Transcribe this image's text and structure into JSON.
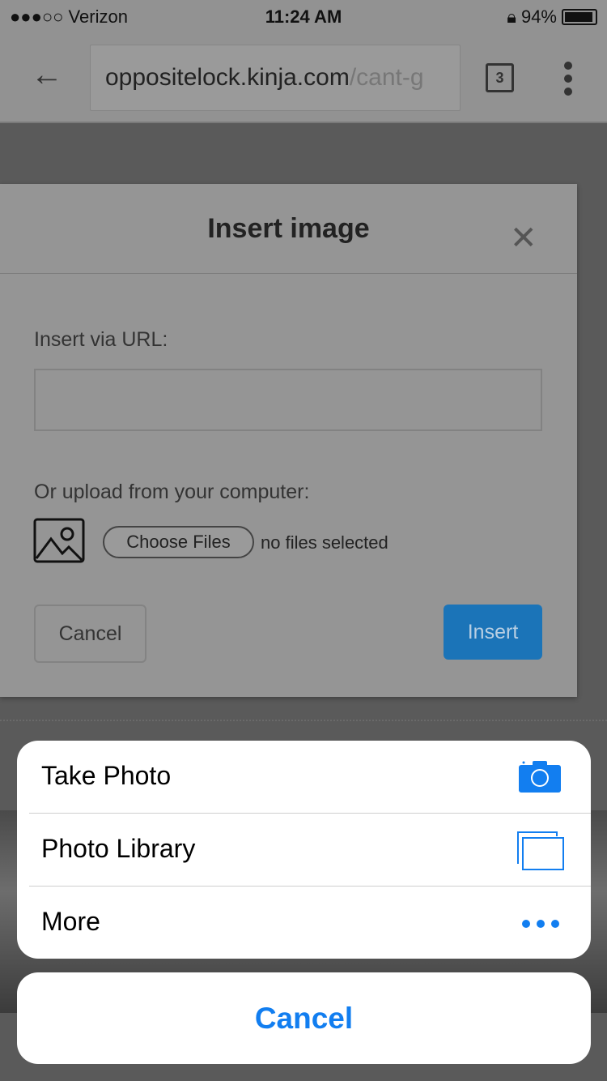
{
  "status_bar": {
    "carrier": "●●●○○ Verizon",
    "time": "11:24 AM",
    "battery": "94%",
    "battery_level": 0.94
  },
  "browser": {
    "url_main": "oppositelock.kinja.com",
    "url_rest": "/cant-g",
    "tab_count": "3"
  },
  "dialog": {
    "title": "Insert image",
    "url_label": "Insert via URL:",
    "url_value": "",
    "upload_label": "Or upload from your computer:",
    "choose_files": "Choose Files",
    "no_files": "no files selected",
    "cancel": "Cancel",
    "insert": "Insert"
  },
  "action_sheet": {
    "items": [
      {
        "label": "Take Photo",
        "icon": "camera-icon"
      },
      {
        "label": "Photo Library",
        "icon": "photo-library-icon"
      },
      {
        "label": "More",
        "icon": "more-icon"
      }
    ],
    "cancel": "Cancel"
  },
  "colors": {
    "accent": "#127ef0"
  }
}
